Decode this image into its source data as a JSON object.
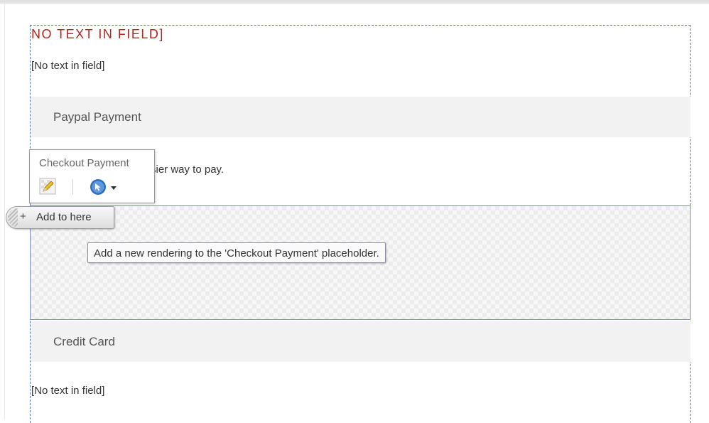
{
  "page": {
    "heading_placeholder": "NO TEXT IN FIELD",
    "heading_bracket": "]",
    "plain_placeholder_top": "[No text in field]",
    "paypal_section": {
      "title": "Paypal Payment",
      "description_visible": "sier way to pay."
    },
    "credit_section": {
      "title": "Credit Card"
    },
    "plain_placeholder_bottom": "[No text in field]"
  },
  "chrome_toolbar": {
    "title": "Checkout Payment",
    "icons": [
      "edit-icon",
      "select-rendering-icon",
      "dropdown-caret-icon"
    ]
  },
  "placeholder_zone": {
    "add_button_label": "Add to here",
    "add_button_icon": "plus-icon",
    "tooltip": "Add a new rendering to the 'Checkout Payment' placeholder."
  },
  "colors": {
    "heading_red": "#b3261e",
    "dashed_border": "#5a74a8",
    "section_band": "#f2f2f2",
    "icon_blue": "#2f6fb8"
  }
}
